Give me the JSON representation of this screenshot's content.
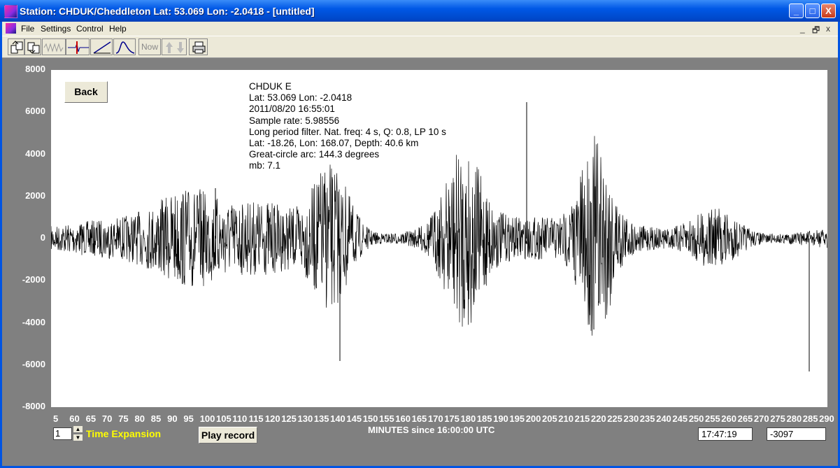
{
  "window": {
    "title": "Station: CHDUK/Cheddleton Lat: 53.069 Lon: -2.0418 - [untitled]",
    "minimize_label": "_",
    "maximize_label": "□",
    "close_label": "X"
  },
  "menu": {
    "items": [
      "File",
      "Settings",
      "Control",
      "Help"
    ],
    "mdi_controls": [
      "_",
      "🗗",
      "x"
    ]
  },
  "toolbar": {
    "now_label": "Now",
    "tools": [
      "open-icon",
      "save-icon",
      "waveform-icon",
      "pick-icon",
      "slope-icon",
      "spectrum-icon",
      "now-button",
      "up-down-icon",
      "print-icon"
    ]
  },
  "plot": {
    "back_label": "Back",
    "info_lines": [
      "CHDUK  E",
      "Lat: 53.069 Lon: -2.0418",
      "2011/08/20 16:55:01",
      "Sample rate: 5.98556",
      "Long period filter. Nat. freq: 4 s, Q: 0.8, LP 10 s",
      "Lat: -18.26, Lon: 168.07, Depth: 40.6 km",
      "Great-circle arc: 144.3 degrees",
      "mb: 7.1"
    ],
    "y_ticks": [
      "8000",
      "6000",
      "4000",
      "2000",
      "0",
      "-2000",
      "-4000",
      "-6000",
      "-8000"
    ],
    "x_ticks": [
      "5",
      "60",
      "65",
      "70",
      "75",
      "80",
      "85",
      "90",
      "95",
      "100",
      "105",
      "110",
      "115",
      "120",
      "125",
      "130",
      "135",
      "140",
      "145",
      "150",
      "155",
      "160",
      "165",
      "170",
      "175",
      "180",
      "185",
      "190",
      "195",
      "200",
      "205",
      "210",
      "215",
      "220",
      "225",
      "230",
      "235",
      "240",
      "245",
      "250",
      "255",
      "260",
      "265",
      "270",
      "275",
      "280",
      "285",
      "290"
    ],
    "xlabel": "MINUTES since 16:00:00 UTC",
    "trace_color": "#000000"
  },
  "bottom": {
    "time_expansion_value": "1",
    "time_expansion_label": "Time Expansion",
    "play_label": "Play record",
    "time_readout": "17:47:19",
    "value_readout": "-3097"
  }
}
